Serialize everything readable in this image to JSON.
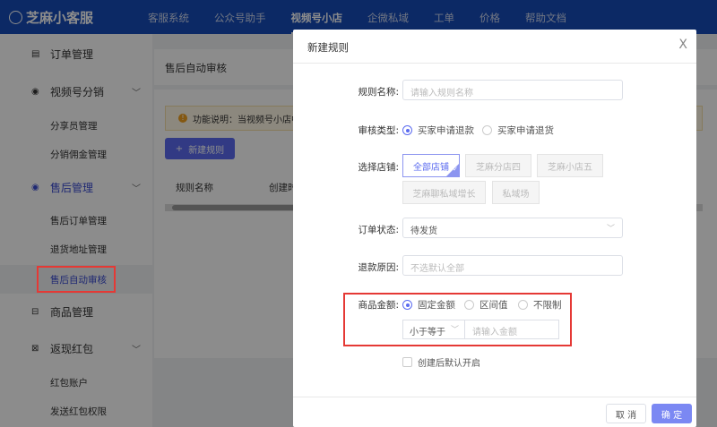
{
  "nav": {
    "brand": "芝麻小客服",
    "items": [
      "客服系统",
      "公众号助手",
      "视频号小店",
      "企微私域",
      "工单",
      "价格",
      "帮助文档"
    ],
    "active_index": 2
  },
  "sidebar": {
    "items": [
      {
        "label": "订单管理",
        "icon": "clipboard-icon"
      },
      {
        "label": "视频号分销",
        "icon": "target-icon",
        "expandable": true
      },
      {
        "label": "分享员管理",
        "sub": true
      },
      {
        "label": "分销佣金管理",
        "sub": true
      },
      {
        "label": "售后管理",
        "icon": "target-icon",
        "expandable": true,
        "highlight": true
      },
      {
        "label": "售后订单管理",
        "sub": true
      },
      {
        "label": "退货地址管理",
        "sub": true
      },
      {
        "label": "售后自动审核",
        "sub": true,
        "active": true
      },
      {
        "label": "商品管理",
        "icon": "box-icon"
      },
      {
        "label": "返现红包",
        "icon": "redpacket-icon",
        "expandable": true
      },
      {
        "label": "红包账户",
        "sub": true
      },
      {
        "label": "发送红包权限",
        "sub": true
      }
    ]
  },
  "main": {
    "title": "售后自动审核",
    "notice": "功能说明：当视频号小店中",
    "new_button": "新建规则",
    "columns": [
      "规则名称",
      "创建时"
    ]
  },
  "modal": {
    "title": "新建规则",
    "close": "X",
    "rule_name": {
      "label": "规则名称:",
      "placeholder": "请输入规则名称"
    },
    "review_type": {
      "label": "审核类型:",
      "options": [
        "买家申请退款",
        "买家申请退货"
      ],
      "selected": 0
    },
    "shops": {
      "label": "选择店铺:",
      "options": [
        "全部店铺",
        "芝麻分店四",
        "芝麻小店五",
        "芝麻聊私域增长",
        "私域场"
      ],
      "selected": 0
    },
    "order_status": {
      "label": "订单状态:",
      "value": "待发货"
    },
    "refund_reason": {
      "label": "退款原因:",
      "placeholder": "不选默认全部"
    },
    "amount": {
      "label": "商品金额:",
      "options": [
        "固定金额",
        "区间值",
        "不限制"
      ],
      "selected": 0,
      "comparator": "小于等于",
      "placeholder": "请输入金额"
    },
    "enable_default": {
      "label": "创建后默认开启",
      "checked": false
    },
    "cancel": "取 消",
    "confirm": "确 定"
  },
  "colors": {
    "accent": "#5b6bf0",
    "nav": "#164cb9",
    "highlight_box": "#e53935"
  }
}
